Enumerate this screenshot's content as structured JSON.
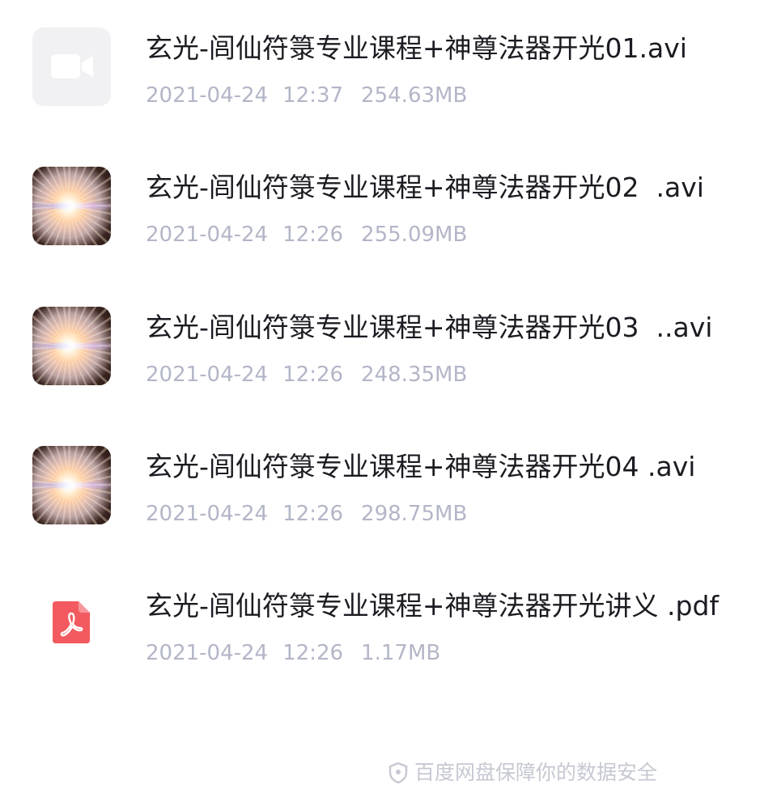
{
  "files": [
    {
      "name": "玄光-闾仙符箓专业课程+神尊法器开光01.avi",
      "date": "2021-04-24",
      "time": "12:37",
      "size": "254.63MB",
      "thumbnail": "video-camera-icon"
    },
    {
      "name": "玄光-闾仙符箓专业课程+神尊法器开光02  .avi",
      "date": "2021-04-24",
      "time": "12:26",
      "size": "255.09MB",
      "thumbnail": "light-burst-thumbnail"
    },
    {
      "name": "玄光-闾仙符箓专业课程+神尊法器开光03  ..avi",
      "date": "2021-04-24",
      "time": "12:26",
      "size": "248.35MB",
      "thumbnail": "light-burst-thumbnail"
    },
    {
      "name": "玄光-闾仙符箓专业课程+神尊法器开光04 .avi",
      "date": "2021-04-24",
      "time": "12:26",
      "size": "298.75MB",
      "thumbnail": "light-burst-thumbnail"
    },
    {
      "name": "玄光-闾仙符箓专业课程+神尊法器开光讲义 .pdf",
      "date": "2021-04-24",
      "time": "12:26",
      "size": "1.17MB",
      "thumbnail": "pdf-icon"
    }
  ],
  "footer": {
    "text": "百度网盘保障你的数据安全",
    "icon": "shield-icon"
  },
  "colors": {
    "filename": "#1b1b22",
    "meta": "#b3b6c7",
    "pdf_red": "#f25a60",
    "placeholder_bg": "#f1f1f3"
  }
}
